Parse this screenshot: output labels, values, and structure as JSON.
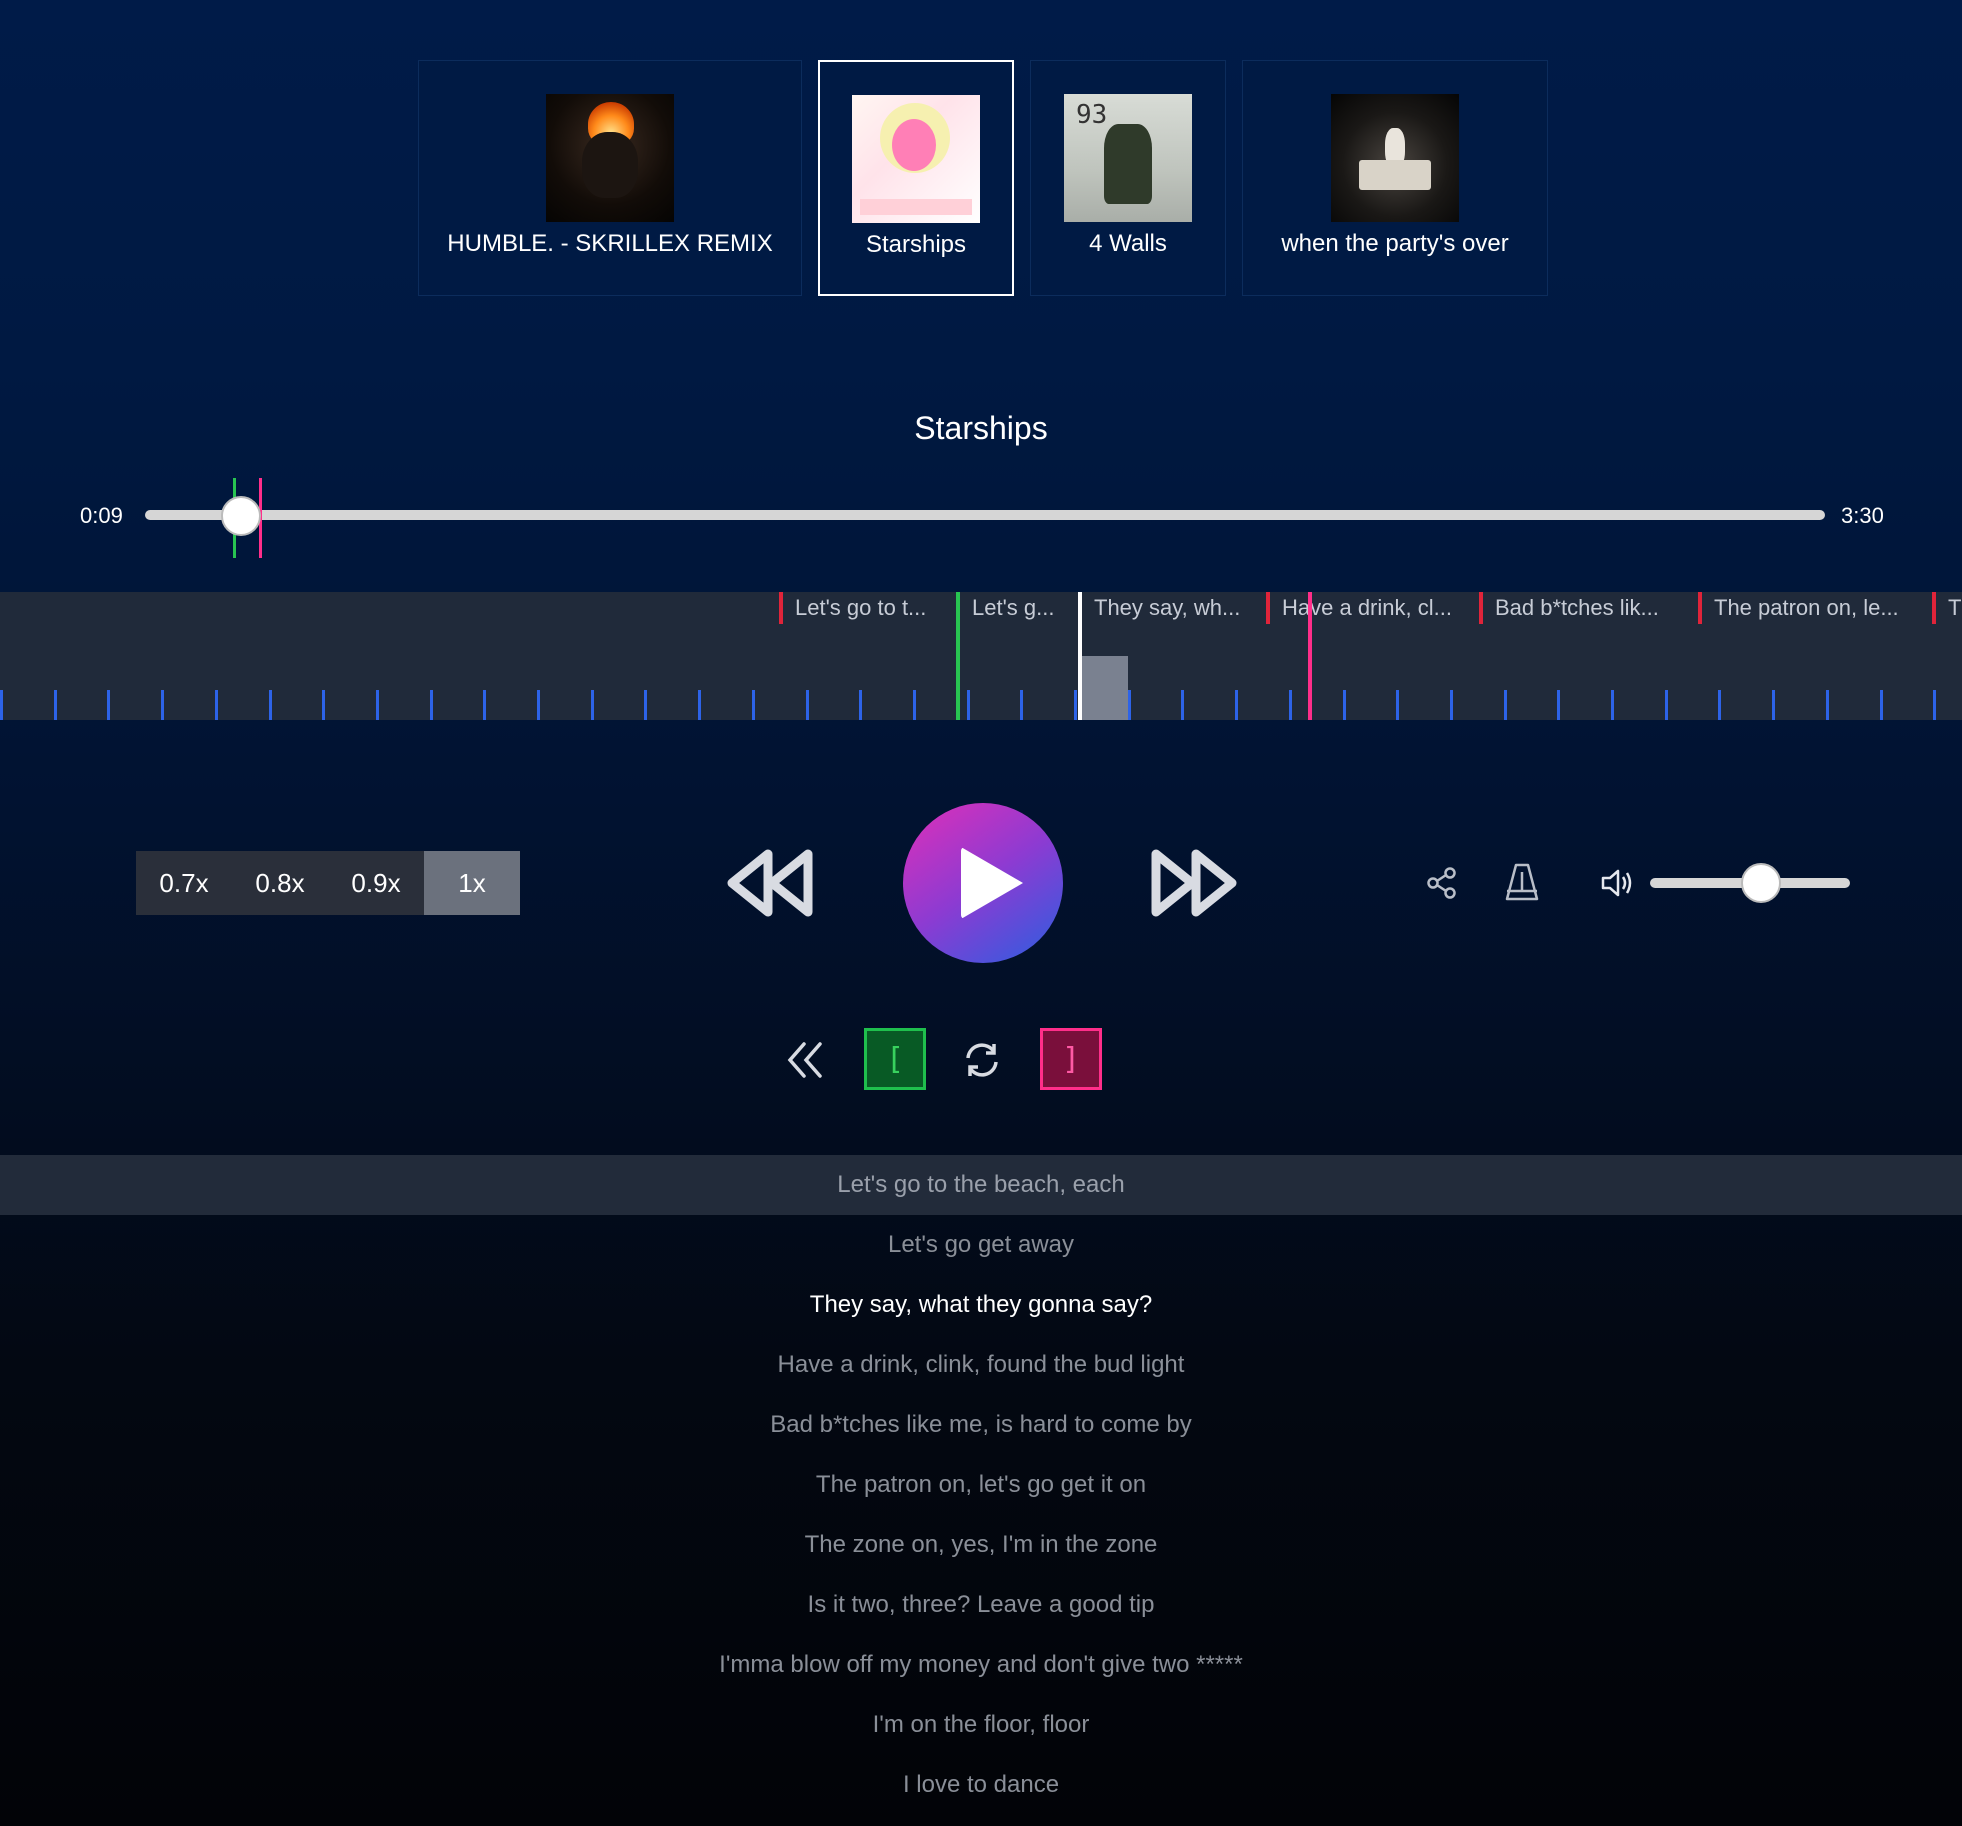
{
  "songs": [
    {
      "title": "HUMBLE. - SKRILLEX REMIX",
      "art": "humble-cover"
    },
    {
      "title": "Starships",
      "art": "starships-cover"
    },
    {
      "title": "4 Walls",
      "art": "four-walls-cover"
    },
    {
      "title": "when the party's over",
      "art": "party-cover"
    }
  ],
  "selected_song": "Starships",
  "player": {
    "title": "Starships",
    "elapsed": "0:09",
    "duration": "3:30",
    "progress_fraction": 0.057,
    "loop_start_fraction": 0.055,
    "loop_end_fraction": 0.07,
    "volume_fraction": 0.55
  },
  "timeline_tags": [
    "Let's go to t...",
    "Let's g...",
    "They say, wh...",
    "Have a drink, cl...",
    "Bad b*tches lik...",
    "The patron on, le...",
    "T"
  ],
  "speeds": [
    "0.7x",
    "0.8x",
    "0.9x",
    "1x"
  ],
  "active_speed": "1x",
  "loop_buttons": {
    "start": "[",
    "end": "]"
  },
  "lyrics": [
    "Let's go to the beach, each",
    "Let's go get away",
    "They say, what they gonna say?",
    "Have a drink, clink, found the bud light",
    "Bad b*tches like me, is hard to come by",
    "The patron on, let's go get it on",
    "The zone on, yes, I'm in the zone",
    "Is it two, three? Leave a good tip",
    "I'mma blow off my money and don't give two *****",
    "I'm on the floor, floor",
    "I love to dance"
  ],
  "colors": {
    "loop_start": "#28c451",
    "loop_end": "#ff2e8a",
    "beat": "#2d63e8",
    "tag": "#e0243a",
    "play_gradient": [
      "#e02fb8",
      "#2a5fe0"
    ]
  }
}
